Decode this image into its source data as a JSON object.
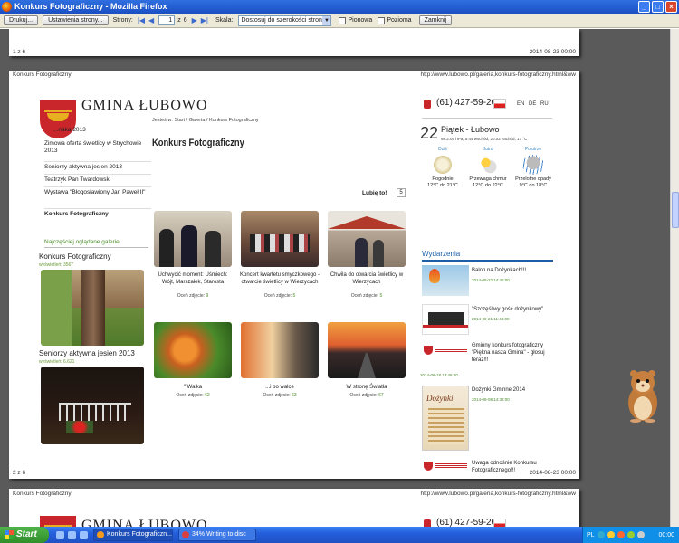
{
  "window": {
    "title": "Konkurs Fotograficzny - Mozilla Firefox"
  },
  "toolbar": {
    "print": "Drukuj...",
    "page_setup": "Ustawienia strony...",
    "pages_label": "Strony:",
    "current_page": "1",
    "of": "z",
    "total_pages": "6",
    "scale_label": "Skala:",
    "scale_value": "Dostosuj do szerokości strony",
    "portrait": "Pionowa",
    "landscape": "Pozioma",
    "close": "Zamknij"
  },
  "pages": {
    "p1_footer_left": "1 z 6",
    "p1_footer_right": "2014-08-23 00:00",
    "p2_header_left": "Konkurs Fotograficzny",
    "p2_header_right": "http://www.lubowo.pl/galeria,konkurs-fotograficzny.html&ww",
    "p2_footer_left": "2 z 6",
    "p2_footer_right": "2014-08-23 00:00",
    "p3_header_left": "Konkurs Fotograficzny",
    "p3_header_right": "http://www.lubowo.pl/galeria,konkurs-fotograficzny.html&ww"
  },
  "site": {
    "name": "GMINA ŁUBOWO",
    "breadcrumb": "Jesteś w: Start / Galeria / Konkurs Fotograficzny",
    "page_title": "Konkurs Fotograficzny",
    "phone": "(61) 427-59-20",
    "langs": [
      "EN",
      "DE",
      "RU"
    ]
  },
  "side_nav": [
    "...naka 2013",
    "Zimowa oferta świetlicy w Strychowie 2013",
    "Seniorzy aktywna jesien 2013",
    "Teatrzyk Pan Twardowski",
    "Wystawa \"Błogosławiony Jan Paweł II\"",
    "Konkurs Fotograficzny"
  ],
  "most_viewed": {
    "heading": "Najczęściej oglądane galerie",
    "items": [
      {
        "title": "Konkurs Fotograficzny",
        "views": "wyświetleń: 3567"
      },
      {
        "title": "Seniorzy aktywna jesien 2013",
        "views": "wyświetleń: 6.621"
      }
    ]
  },
  "sort": {
    "label": "Lubię to!",
    "count": "5"
  },
  "gallery": [
    {
      "caption": "Uchwycić moment: Uśmiech: Wójt, Marszałek, Starosta",
      "count_label": "Oceń zdjęcie:",
      "count": "9"
    },
    {
      "caption": "Koncert kwartetu smyczkowego - otwarcie świetlicy w Wierzycach",
      "count_label": "Oceń zdjęcie:",
      "count": "5"
    },
    {
      "caption": "Chwila do otwarcia świetlicy w Wierzycach",
      "count_label": "Oceń zdjęcie:",
      "count": "5"
    },
    {
      "caption": "\" Walka",
      "count_label": "Oceń zdjęcie:",
      "count": "62"
    },
    {
      "caption": "...i po walce",
      "count_label": "Oceń zdjęcie:",
      "count": "63"
    },
    {
      "caption": "W stronę Światła",
      "count_label": "Oceń zdjęcie:",
      "count": "67"
    }
  ],
  "weather": {
    "day": "22",
    "title": "Piątek - Łubowo",
    "details": "98.2.05 hPa, 5:44 wschód, 20:02 zachód, 17 °C",
    "cols": [
      {
        "label": "Dziś",
        "desc": "Pogodnie",
        "temp": "12°C do 21°C"
      },
      {
        "label": "Jutro",
        "desc": "Przewaga chmur",
        "temp": "12°C do 22°C"
      },
      {
        "label": "Pojutrze",
        "desc": "Przelotne opady",
        "temp": "9°C do 18°C"
      }
    ]
  },
  "events": {
    "heading": "Wydarzenia",
    "items": [
      {
        "title": "Balon na Dożynkach!!!",
        "date": "2014-08-22 14:45:00"
      },
      {
        "title": "\"Szczęśliwy gość dożynkowy\"",
        "date": "2014-08-21 11:48:00"
      },
      {
        "title": "Gminny konkurs fotograficzny \"Piękna nasza Gmina\" - głosuj teraz!!!",
        "date": "2014-08-18 13:46:00"
      },
      {
        "title": "Dożynki Gminne 2014",
        "date": "2014-08-08 14:32:00"
      },
      {
        "title": "Uwaga odnośnie Konkursu Fotograficznego!!!",
        "date": ""
      }
    ]
  },
  "taskbar": {
    "start": "Start",
    "task1": "Konkurs Fotograficzn...",
    "task2": "34% Writing to disc",
    "lang": "PL",
    "clock": "00:00"
  }
}
